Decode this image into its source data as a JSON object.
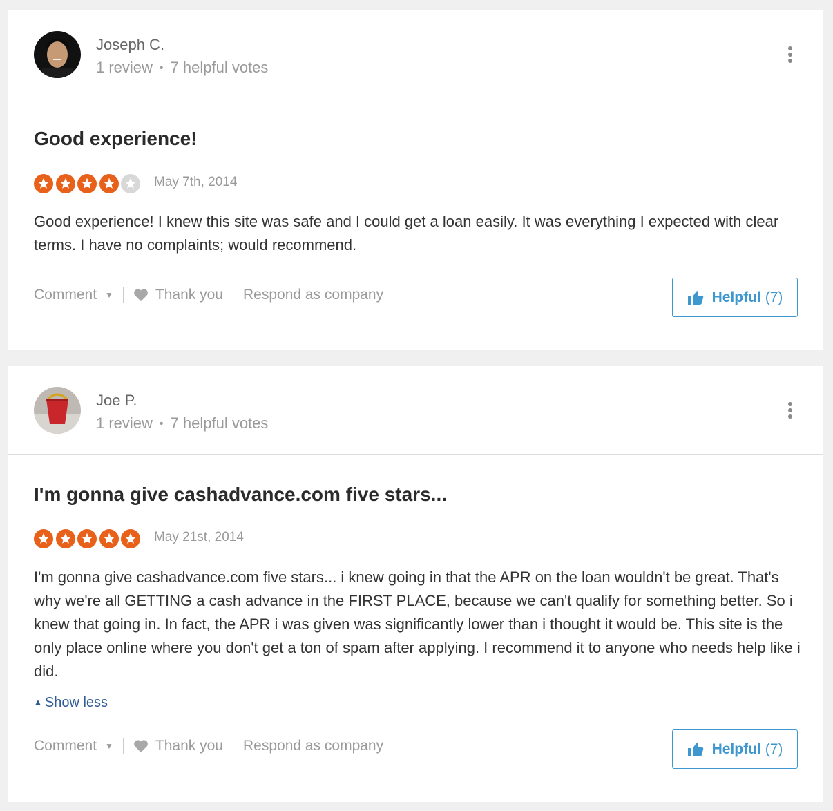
{
  "reviews": [
    {
      "reviewer": {
        "name": "Joseph C.",
        "reviews": "1 review",
        "votes": "7 helpful votes"
      },
      "title": "Good experience!",
      "rating": 4,
      "date": "May 7th, 2014",
      "body": "Good experience! I knew this site was safe and I could get a loan easily. It was everything I expected with clear terms. I have no complaints; would recommend.",
      "actions": {
        "comment": "Comment",
        "thank": "Thank you",
        "respond": "Respond as company"
      },
      "helpful": {
        "label": "Helpful",
        "count": "(7)"
      }
    },
    {
      "reviewer": {
        "name": "Joe P.",
        "reviews": "1 review",
        "votes": "7 helpful votes"
      },
      "title": "I'm gonna give cashadvance.com five stars...",
      "rating": 5,
      "date": "May 21st, 2014",
      "body": "I'm gonna give cashadvance.com five stars... i knew going in that the APR on the loan wouldn't be great. That's why we're all GETTING a cash advance in the FIRST PLACE, because we can't qualify for something better. So i knew that going in. In fact, the APR i was given was significantly lower than i thought it would be. This site is the only place online where you don't get a ton of spam after applying. I recommend it to anyone who needs help like i did.",
      "show_less": "Show less",
      "actions": {
        "comment": "Comment",
        "thank": "Thank you",
        "respond": "Respond as company"
      },
      "helpful": {
        "label": "Helpful",
        "count": "(7)"
      }
    }
  ],
  "colors": {
    "star_on": "#e8611a",
    "star_off": "#d8d8d8",
    "accent": "#3f97cf",
    "link": "#2f5c96"
  }
}
